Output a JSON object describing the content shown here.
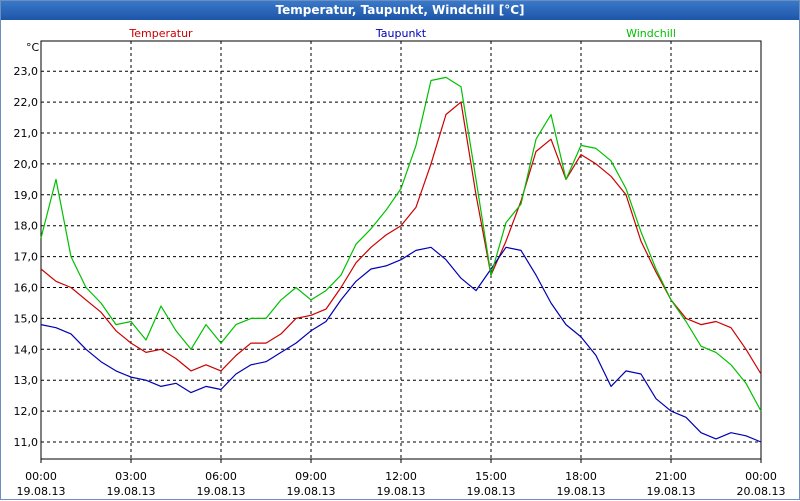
{
  "window": {
    "title": "Temperatur, Taupunkt, Windchill [°C]"
  },
  "chart_data": {
    "type": "line",
    "title": "Temperatur, Taupunkt, Windchill [°C]",
    "ylabel": "°C",
    "ylim": [
      10.5,
      23.9
    ],
    "yticks": [
      "11,0",
      "12,0",
      "13,0",
      "14,0",
      "15,0",
      "16,0",
      "17,0",
      "18,0",
      "19,0",
      "20,0",
      "21,0",
      "22,0",
      "23,0"
    ],
    "xticks": [
      {
        "time": "00:00",
        "date": "19.08.13"
      },
      {
        "time": "03:00",
        "date": "19.08.13"
      },
      {
        "time": "06:00",
        "date": "19.08.13"
      },
      {
        "time": "09:00",
        "date": "19.08.13"
      },
      {
        "time": "12:00",
        "date": "19.08.13"
      },
      {
        "time": "15:00",
        "date": "19.08.13"
      },
      {
        "time": "18:00",
        "date": "19.08.13"
      },
      {
        "time": "21:00",
        "date": "19.08.13"
      },
      {
        "time": "00:00",
        "date": "20.08.13"
      }
    ],
    "grid": true,
    "x_hours": [
      0,
      0.5,
      1,
      1.5,
      2,
      2.5,
      3,
      3.5,
      4,
      4.5,
      5,
      5.5,
      6,
      6.5,
      7,
      7.5,
      8,
      8.5,
      9,
      9.5,
      10,
      10.5,
      11,
      11.5,
      12,
      12.5,
      13,
      13.5,
      14,
      14.5,
      15,
      15.5,
      16,
      16.5,
      17,
      17.5,
      18,
      18.5,
      19,
      19.5,
      20,
      20.5,
      21,
      21.5,
      22,
      22.5,
      23,
      23.5,
      24
    ],
    "series": [
      {
        "name": "Temperatur",
        "color": "#cc0000",
        "values": [
          16.6,
          16.2,
          16.0,
          15.6,
          15.2,
          14.6,
          14.2,
          13.9,
          14.0,
          13.7,
          13.3,
          13.5,
          13.3,
          13.8,
          14.2,
          14.2,
          14.5,
          15.0,
          15.1,
          15.3,
          16.0,
          16.8,
          17.3,
          17.7,
          18.0,
          18.6,
          20.0,
          21.6,
          22.0,
          19.0,
          16.4,
          17.5,
          18.8,
          20.4,
          20.8,
          19.5,
          20.3,
          20.0,
          19.6,
          19.0,
          17.5,
          16.5,
          15.6,
          15.0,
          14.8,
          14.9,
          14.7,
          14.0,
          13.2
        ]
      },
      {
        "name": "Taupunkt",
        "color": "#0000b4",
        "values": [
          14.8,
          14.7,
          14.5,
          14.0,
          13.6,
          13.3,
          13.1,
          13.0,
          12.8,
          12.9,
          12.6,
          12.8,
          12.7,
          13.2,
          13.5,
          13.6,
          13.9,
          14.2,
          14.6,
          14.9,
          15.6,
          16.2,
          16.6,
          16.7,
          16.9,
          17.2,
          17.3,
          16.9,
          16.3,
          15.9,
          16.6,
          17.3,
          17.2,
          16.4,
          15.5,
          14.8,
          14.4,
          13.8,
          12.8,
          13.3,
          13.2,
          12.4,
          12.0,
          11.8,
          11.3,
          11.1,
          11.3,
          11.2,
          11.0
        ]
      },
      {
        "name": "Windchill",
        "color": "#00c000",
        "values": [
          17.6,
          19.5,
          17.0,
          16.0,
          15.5,
          14.8,
          14.9,
          14.3,
          15.4,
          14.6,
          14.0,
          14.8,
          14.2,
          14.8,
          15.0,
          15.0,
          15.6,
          16.0,
          15.6,
          15.9,
          16.4,
          17.4,
          17.9,
          18.5,
          19.2,
          20.6,
          22.7,
          22.8,
          22.5,
          19.5,
          16.4,
          18.1,
          18.7,
          20.8,
          21.6,
          19.5,
          20.6,
          20.5,
          20.1,
          19.2,
          17.8,
          16.6,
          15.6,
          14.9,
          14.1,
          13.9,
          13.5,
          12.9,
          12.0
        ]
      }
    ]
  }
}
